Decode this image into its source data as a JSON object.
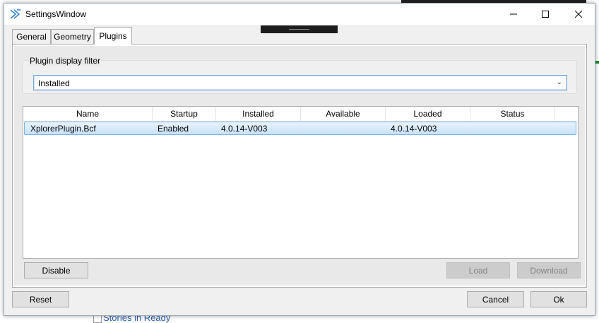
{
  "window": {
    "title": "SettingsWindow"
  },
  "tabs": [
    {
      "label": "General"
    },
    {
      "label": "Geometry"
    },
    {
      "label": "Plugins"
    }
  ],
  "plugins_tab": {
    "filter_group_label": "Plugin display filter",
    "filter_selected": "Installed",
    "columns": [
      "Name",
      "Startup",
      "Installed",
      "Available",
      "Loaded",
      "Status"
    ],
    "rows": [
      {
        "name": "XplorerPlugin.Bcf",
        "startup": "Enabled",
        "installed": "4.0.14-V003",
        "available": "",
        "loaded": "4.0.14-V003",
        "status": ""
      }
    ],
    "disable_label": "Disable",
    "load_label": "Load",
    "download_label": "Download"
  },
  "footer": {
    "reset_label": "Reset",
    "cancel_label": "Cancel",
    "ok_label": "Ok"
  },
  "background": {
    "stories_text": "Stories in Ready"
  },
  "colors": {
    "accent": "#7fb4e6",
    "selection_top": "#e8f3fd",
    "selection_bottom": "#c9e1f8"
  }
}
